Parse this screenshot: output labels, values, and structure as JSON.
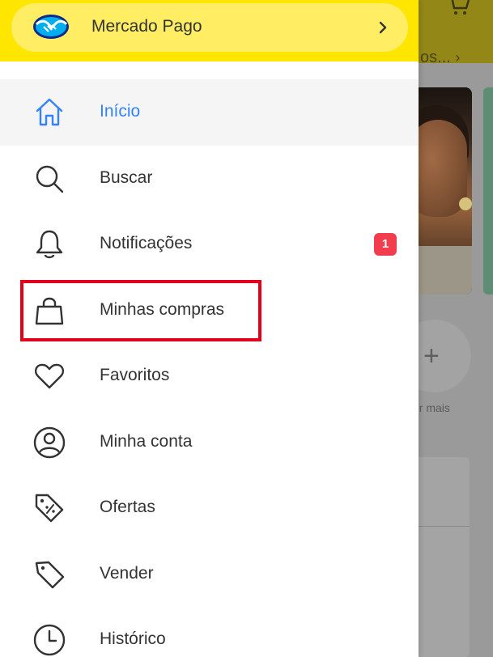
{
  "colors": {
    "brand_yellow": "#ffe600",
    "pill_yellow": "#ffed63",
    "active_blue": "#3483fa",
    "text": "#333333",
    "badge_red": "#f23d4f",
    "highlight_red": "#e3001b"
  },
  "background": {
    "breadcrumb_fragment": "os...",
    "see_more_fragment": "er mais",
    "plus_glyph": "+"
  },
  "header": {
    "mercado_pago_label": "Mercado Pago",
    "chevron_icon": "chevron-right-icon",
    "logo_icon": "mercado-pago-handshake-logo"
  },
  "menu": {
    "items": [
      {
        "label": "Início",
        "icon": "home-icon",
        "active": true
      },
      {
        "label": "Buscar",
        "icon": "search-icon"
      },
      {
        "label": "Notificações",
        "icon": "bell-icon",
        "badge": "1"
      },
      {
        "label": "Minhas compras",
        "icon": "shopping-bag-icon",
        "highlighted": true
      },
      {
        "label": "Favoritos",
        "icon": "heart-icon"
      },
      {
        "label": "Minha conta",
        "icon": "user-circle-icon"
      },
      {
        "label": "Ofertas",
        "icon": "discount-tag-icon"
      },
      {
        "label": "Vender",
        "icon": "tag-icon"
      },
      {
        "label": "Histórico",
        "icon": "clock-icon"
      }
    ]
  }
}
